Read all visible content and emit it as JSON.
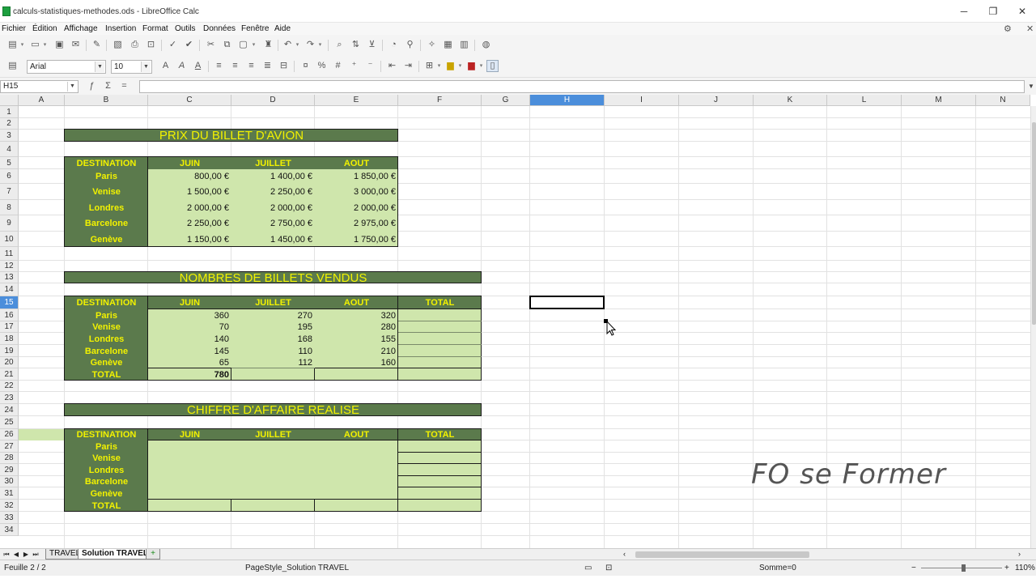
{
  "window": {
    "title": "calculs-statistiques-methodes.ods - LibreOffice Calc",
    "controls": [
      "─",
      "❐",
      "✕"
    ]
  },
  "menu": {
    "items": [
      "Fichier",
      "Édition",
      "Affichage",
      "Insertion",
      "Format",
      "Outils",
      "Données",
      "Fenêtre",
      "Aide"
    ]
  },
  "toolbar": {
    "font_name": "Arial",
    "font_size": "10"
  },
  "formula_bar": {
    "cell_ref": "H15",
    "input": ""
  },
  "columns": [
    "A",
    "B",
    "C",
    "D",
    "E",
    "F",
    "G",
    "H",
    "I",
    "J",
    "K",
    "L",
    "M",
    "N"
  ],
  "rows": [
    "1",
    "2",
    "3",
    "4",
    "5",
    "6",
    "7",
    "8",
    "9",
    "10",
    "11",
    "12",
    "13",
    "14",
    "15",
    "16",
    "17",
    "18",
    "19",
    "20",
    "21",
    "22",
    "23",
    "24",
    "25",
    "26",
    "27",
    "28",
    "29",
    "30",
    "31",
    "32",
    "33",
    "34"
  ],
  "selected": {
    "column": "H",
    "row": "15"
  },
  "sheet": {
    "prix": {
      "title": "PRIX DU BILLET D'AVION",
      "headers": [
        "DESTINATION",
        "JUIN",
        "JUILLET",
        "AOUT"
      ],
      "rows": [
        {
          "dest": "Paris",
          "values": [
            "800,00 €",
            "1 400,00 €",
            "1 850,00 €"
          ]
        },
        {
          "dest": "Venise",
          "values": [
            "1 500,00 €",
            "2 250,00 €",
            "3 000,00 €"
          ]
        },
        {
          "dest": "Londres",
          "values": [
            "2 000,00 €",
            "2 000,00 €",
            "2 000,00 €"
          ]
        },
        {
          "dest": "Barcelone",
          "values": [
            "2 250,00 €",
            "2 750,00 €",
            "2 975,00 €"
          ]
        },
        {
          "dest": "Genève",
          "values": [
            "1 150,00 €",
            "1 450,00 €",
            "1 750,00 €"
          ]
        }
      ]
    },
    "billets": {
      "title": "NOMBRES DE BILLETS VENDUS",
      "headers": [
        "DESTINATION",
        "JUIN",
        "JUILLET",
        "AOUT",
        "TOTAL"
      ],
      "rows": [
        {
          "dest": "Paris",
          "values": [
            "360",
            "270",
            "320",
            ""
          ]
        },
        {
          "dest": "Venise",
          "values": [
            "70",
            "195",
            "280",
            ""
          ]
        },
        {
          "dest": "Londres",
          "values": [
            "140",
            "168",
            "155",
            ""
          ]
        },
        {
          "dest": "Barcelone",
          "values": [
            "145",
            "110",
            "210",
            ""
          ]
        },
        {
          "dest": "Genève",
          "values": [
            "65",
            "112",
            "160",
            ""
          ]
        }
      ],
      "total_label": "TOTAL",
      "totals": [
        "780",
        "",
        "",
        ""
      ]
    },
    "chiffre": {
      "title": "CHIFFRE D'AFFAIRE REALISE",
      "headers": [
        "DESTINATION",
        "JUIN",
        "JUILLET",
        "AOUT",
        "TOTAL"
      ],
      "destinations": [
        "Paris",
        "Venise",
        "Londres",
        "Barcelone",
        "Genève"
      ],
      "total_label": "TOTAL"
    }
  },
  "watermark": "FO se Former",
  "tabs": {
    "items": [
      {
        "label": "TRAVEL",
        "active": false
      },
      {
        "label": "Solution TRAVEL",
        "active": true
      }
    ],
    "add": "+"
  },
  "status": {
    "sheet": "Feuille 2 / 2",
    "page_style": "PageStyle_Solution TRAVEL",
    "sum": "Somme=0",
    "zoom": "110%"
  }
}
